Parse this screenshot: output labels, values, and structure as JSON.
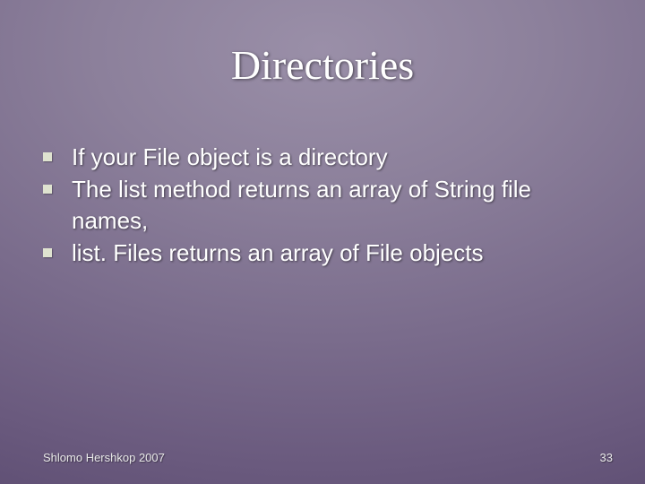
{
  "slide": {
    "title": "Directories",
    "bullets": [
      "If your File object is a directory",
      "The list method returns an array of String file names,",
      "list. Files returns an array of File objects"
    ],
    "footer_author": "Shlomo Hershkop 2007",
    "footer_page": "33"
  }
}
